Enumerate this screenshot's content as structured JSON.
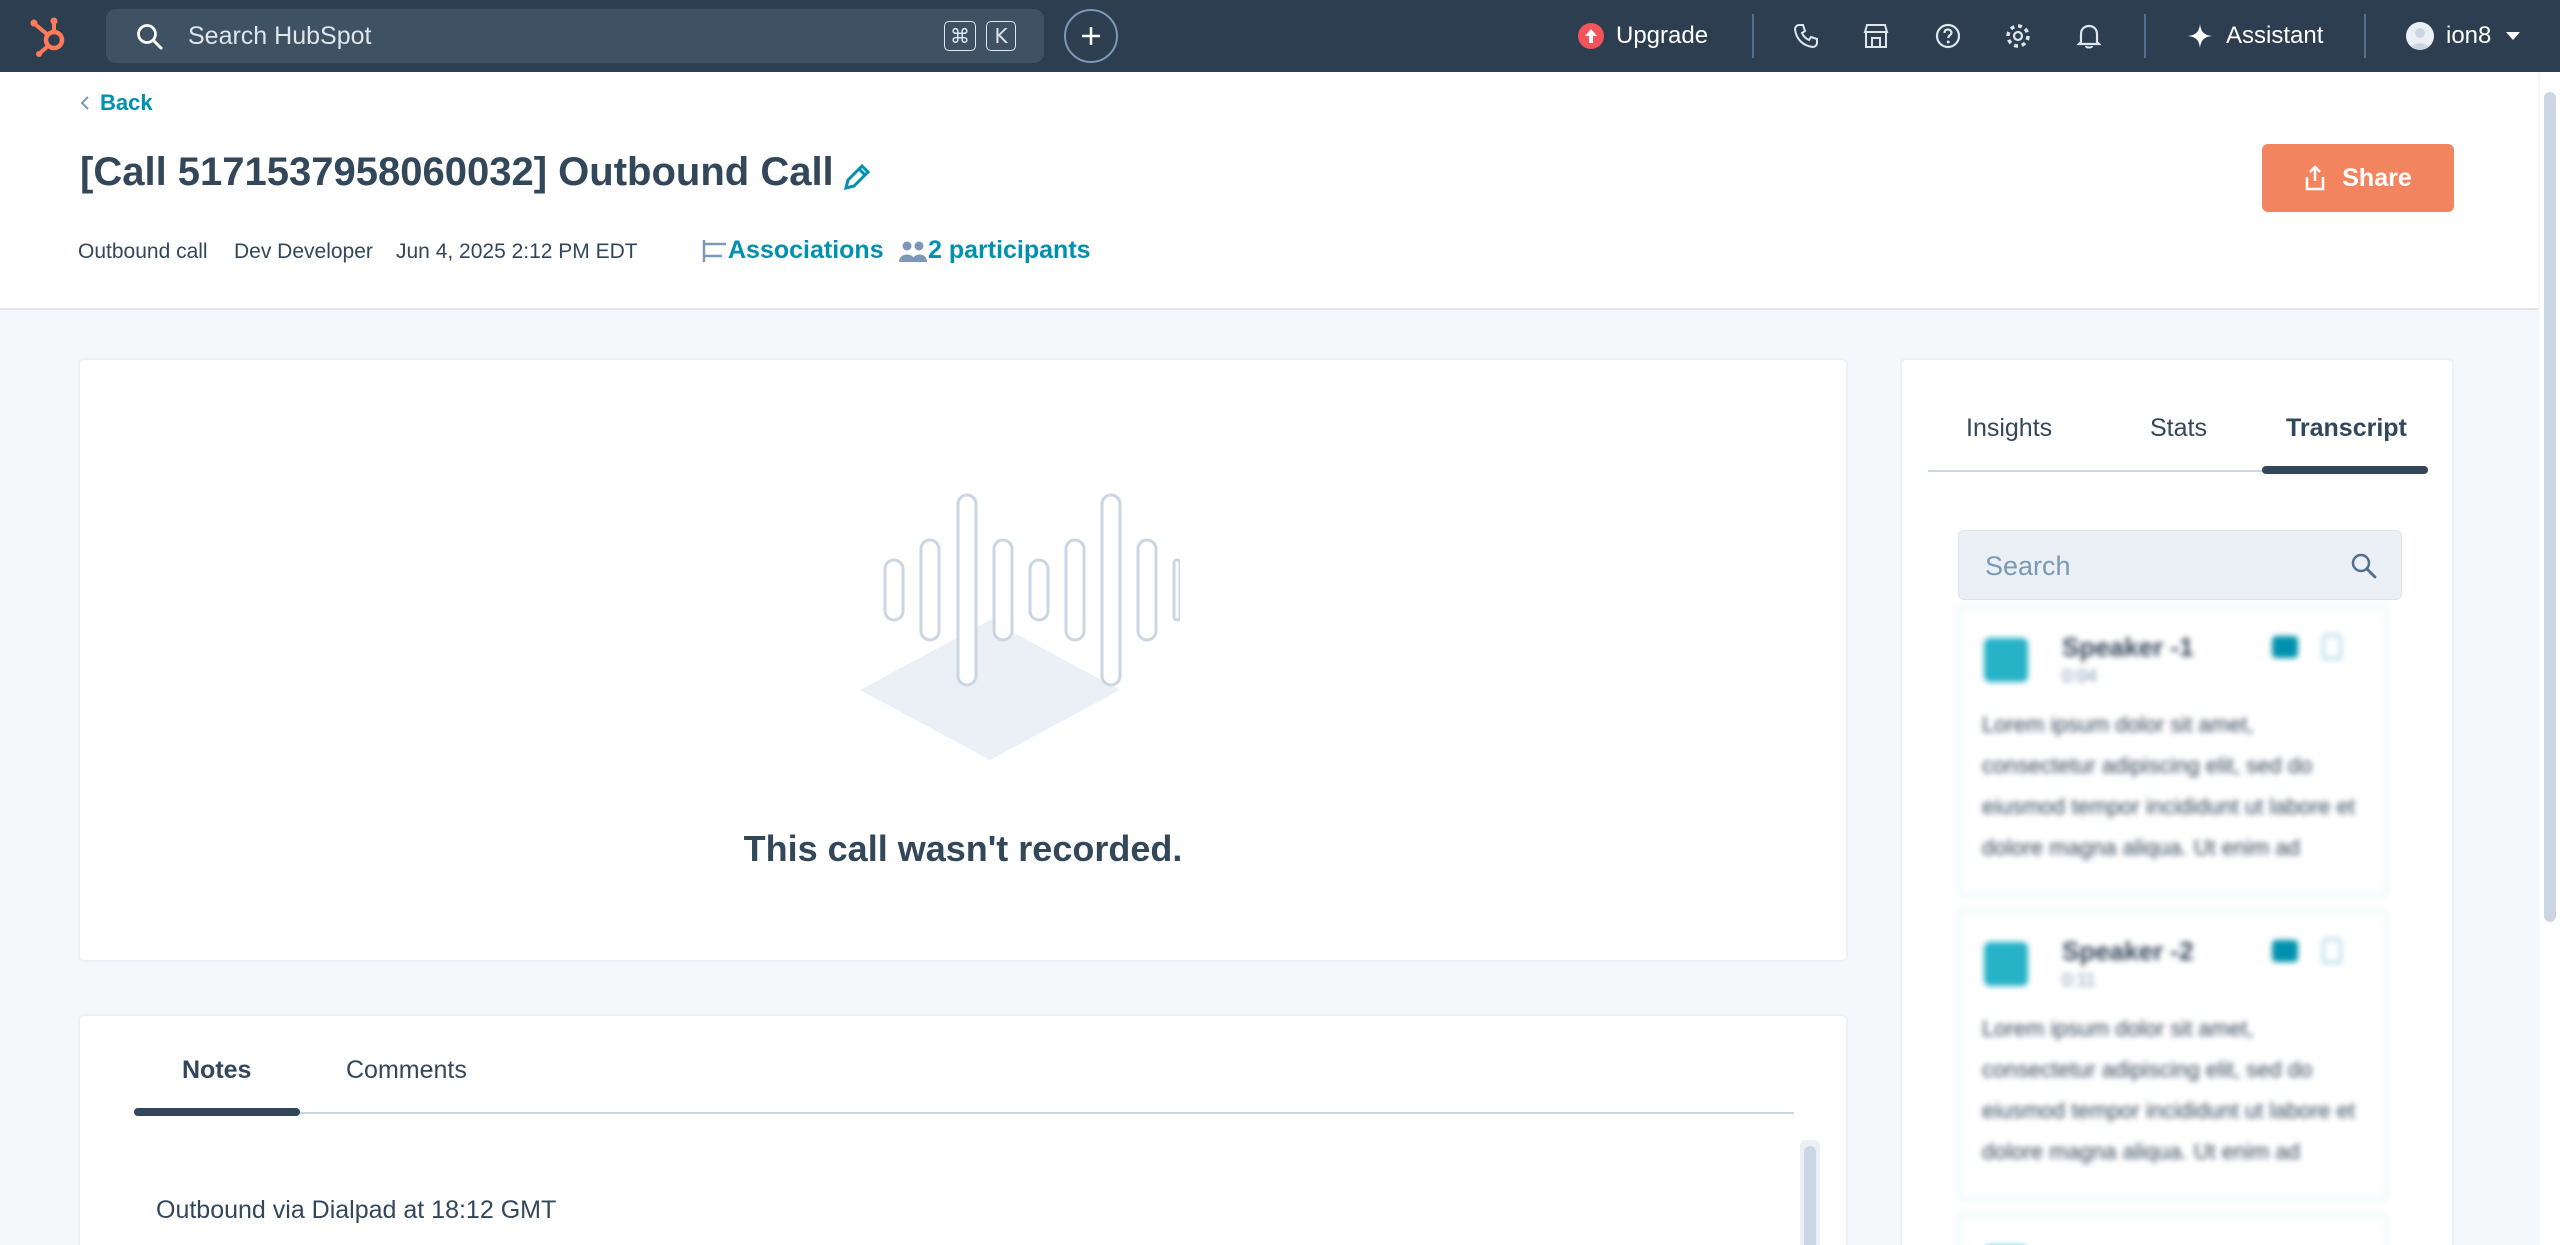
{
  "topnav": {
    "search_placeholder": "Search HubSpot",
    "shortcut_keys": [
      "⌘",
      "K"
    ],
    "upgrade_label": "Upgrade",
    "assistant_label": "Assistant",
    "account_name": "ion8",
    "icons": [
      "phone-icon",
      "marketplace-icon",
      "help-icon",
      "settings-icon",
      "notifications-icon"
    ]
  },
  "header": {
    "back_label": "Back",
    "title": "[Call 5171537958060032] Outbound Call",
    "meta": {
      "call_type": "Outbound call",
      "owner": "Dev Developer",
      "datetime": "Jun 4, 2025 2:12 PM EDT"
    },
    "associations_label": "Associations",
    "participants_label": "2 participants",
    "share_label": "Share"
  },
  "recording": {
    "empty_message": "This call wasn't recorded."
  },
  "notes": {
    "tabs": [
      {
        "label": "Notes",
        "active": true
      },
      {
        "label": "Comments",
        "active": false
      }
    ],
    "body": "Outbound via Dialpad at 18:12 GMT"
  },
  "side_panel": {
    "tabs": [
      {
        "label": "Insights",
        "active": false
      },
      {
        "label": "Stats",
        "active": false
      },
      {
        "label": "Transcript",
        "active": true
      }
    ],
    "search_placeholder": "Search",
    "transcript": [
      {
        "speaker": "Speaker -1",
        "time": "0:04",
        "text": "Lorem ipsum dolor sit amet, consectetur adipiscing elit, sed do eiusmod tempor incididunt ut labore et dolore magna aliqua. Ut enim ad"
      },
      {
        "speaker": "Speaker -2",
        "time": "0:11",
        "text": "Lorem ipsum dolor sit amet, consectetur adipiscing elit, sed do eiusmod tempor incididunt ut labore et dolore magna aliqua. Ut enim ad"
      }
    ]
  },
  "colors": {
    "nav_bg": "#2d3e50",
    "accent": "#0091ae",
    "share": "#f2845f",
    "logo": "#ff7a59"
  }
}
